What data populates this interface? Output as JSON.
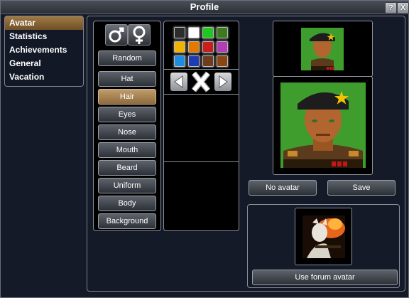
{
  "window": {
    "title": "Profile",
    "help_label": "?",
    "close_label": "X"
  },
  "nav": {
    "items": [
      {
        "label": "Avatar",
        "active": true
      },
      {
        "label": "Statistics"
      },
      {
        "label": "Achievements"
      },
      {
        "label": "General"
      },
      {
        "label": "Vacation"
      }
    ]
  },
  "editor": {
    "gender_buttons": [
      {
        "icon": "male-icon"
      },
      {
        "icon": "female-icon"
      }
    ],
    "random_label": "Random",
    "categories": [
      {
        "label": "Hat"
      },
      {
        "label": "Hair",
        "selected": true
      },
      {
        "label": "Eyes"
      },
      {
        "label": "Nose"
      },
      {
        "label": "Mouth"
      },
      {
        "label": "Beard"
      },
      {
        "label": "Uniform"
      },
      {
        "label": "Body"
      },
      {
        "label": "Background"
      }
    ],
    "colors": [
      "#2c2c2c",
      "#ffffff",
      "#1ec81e",
      "#3c7a1e",
      "#f0b400",
      "#e67800",
      "#c81e1e",
      "#b43cb4",
      "#1e8cdc",
      "#1e3cb4",
      "#6e3c1e",
      "#8c4614"
    ]
  },
  "preview": {
    "no_avatar_label": "No avatar",
    "save_label": "Save",
    "use_forum_label": "Use forum avatar"
  }
}
